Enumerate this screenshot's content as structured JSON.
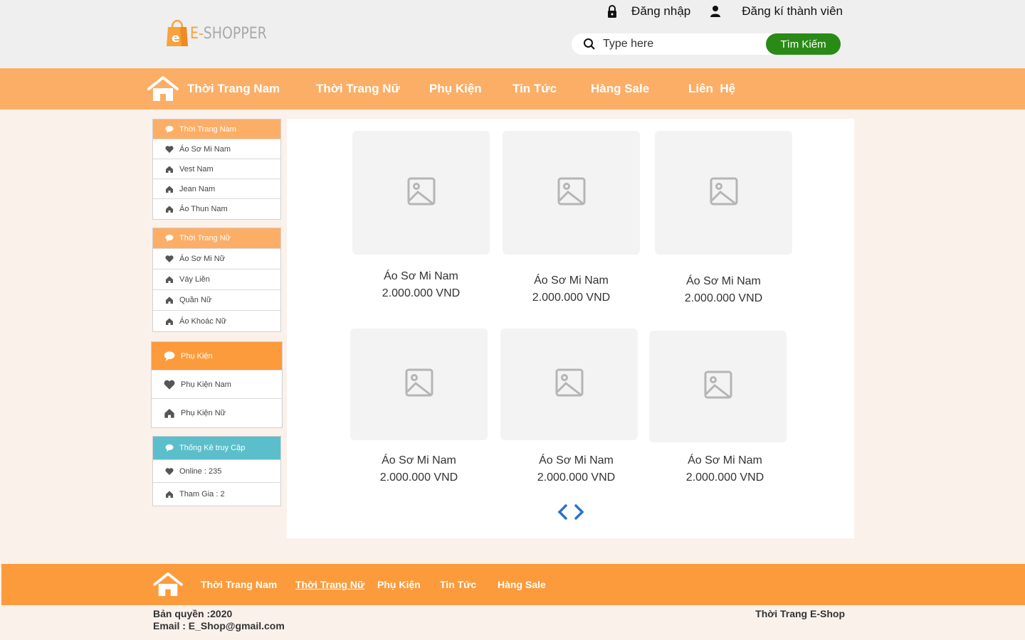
{
  "header": {
    "logo_e": "e",
    "logo_prefix": "E-",
    "logo_rest": "SHOPPER",
    "login": "Đăng nhập",
    "register": "Đăng kí thành viên",
    "search_placeholder": "Type here",
    "search_button": "Tìm Kiếm"
  },
  "nav": {
    "items": [
      "Thời Trang Nam",
      "Thời Trang Nữ",
      "Phụ Kiện",
      "Tin Tức",
      "Hàng Sale",
      "Liên  Hệ"
    ]
  },
  "sidebar": {
    "men": {
      "title": "Thời Trang Nam",
      "items": [
        "Áo Sơ Mi Nam",
        "Vest Nam",
        "Jean Nam",
        "Áo Thun Nam"
      ]
    },
    "women": {
      "title": "Thời Trang Nữ",
      "items": [
        "Áo Sơ Mi Nữ",
        "Váy Liền",
        "Quần Nữ",
        "Áo Khoác Nữ"
      ]
    },
    "accessories": {
      "title": "Phụ Kiện",
      "items": [
        "Phụ Kiện Nam",
        "Phụ Kiện Nữ"
      ]
    },
    "stats": {
      "title": "Thống Kê truy Cập",
      "items": [
        "Online : 235",
        "Tham Gia : 2"
      ]
    }
  },
  "products": [
    {
      "name": "Áo Sơ Mi Nam",
      "price": "2.000.000 VND"
    },
    {
      "name": "Áo Sơ Mi Nam",
      "price": "2.000.000 VND"
    },
    {
      "name": "Áo Sơ Mi Nam",
      "price": "2.000.000 VND"
    },
    {
      "name": "Áo Sơ Mi Nam",
      "price": "2.000.000 VND"
    },
    {
      "name": "Áo Sơ Mi Nam",
      "price": "2.000.000 VND"
    },
    {
      "name": "Áo Sơ Mi Nam",
      "price": "2.000.000 VND"
    }
  ],
  "footer": {
    "items": [
      "Thời Trang Nam",
      "Thời Trang Nữ",
      "Phụ Kiện",
      "Tin Tức",
      "Hàng Sale"
    ],
    "copyright": "Bản quyền :2020",
    "email": "Email : E_Shop@gmail.com",
    "brand": "Thời Trang E-Shop"
  },
  "colors": {
    "nav_bg": "#fcae66",
    "footer_bg": "#fc9b3c",
    "panel_head_orange": "#fcae66",
    "panel_head_orange_dark": "#fc9b3c",
    "panel_head_teal": "#5bbfcb",
    "search_button": "#2a8a16",
    "page_bg": "#fbf1eb"
  },
  "icons": [
    "lock-icon",
    "user-icon",
    "search-icon",
    "home-icon",
    "comment-icon",
    "heart-icon",
    "house-icon",
    "image-placeholder-icon",
    "chevron-left-icon",
    "chevron-right-icon",
    "shopping-bag-icon"
  ]
}
